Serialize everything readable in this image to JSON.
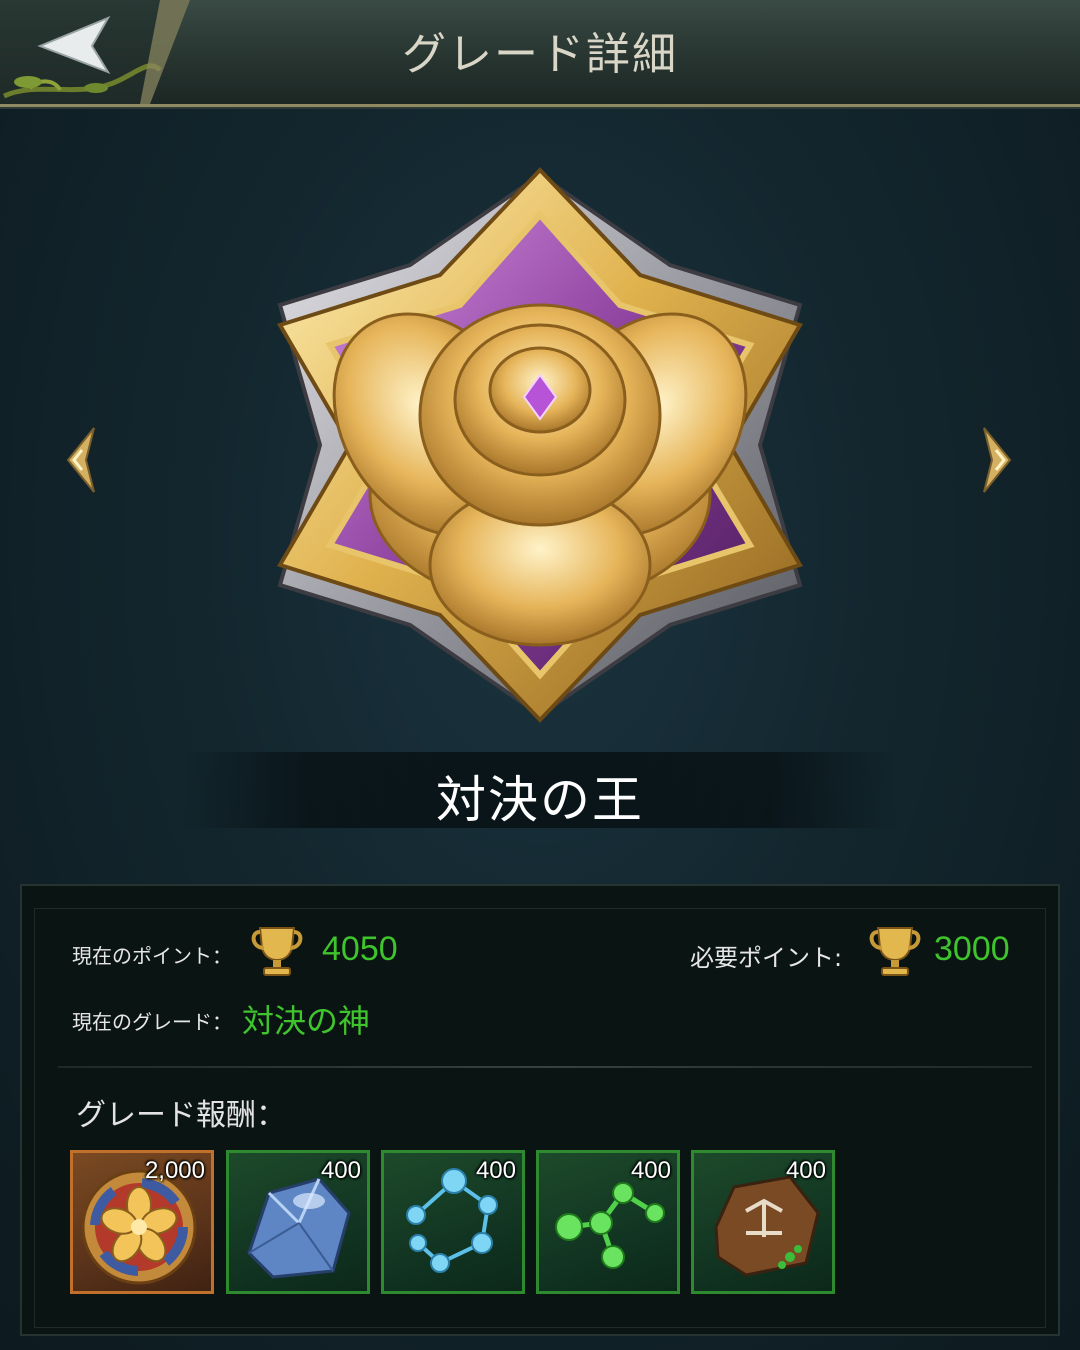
{
  "header": {
    "title": "グレード詳細"
  },
  "grade": {
    "name": "対決の王",
    "emblem_icon": "golden-rose-emblem"
  },
  "info": {
    "current_points_label": "現在のポイント：",
    "current_points_value": "4050",
    "required_points_label": "必要ポイント:",
    "required_points_value": "3000",
    "current_grade_label": "現在のグレード：",
    "current_grade_value": "対決の神"
  },
  "rewards": {
    "label": "グレード報酬：",
    "items": [
      {
        "icon": "gold-flower-medal-icon",
        "count": "2,000"
      },
      {
        "icon": "blue-crystal-icon",
        "count": "400"
      },
      {
        "icon": "blue-molecule-icon",
        "count": "400"
      },
      {
        "icon": "green-molecule-icon",
        "count": "400"
      },
      {
        "icon": "rune-stone-icon",
        "count": "400"
      }
    ]
  },
  "colors": {
    "value_green": "#3fc42d",
    "reward_border_green": "#2e8a2e",
    "reward_border_orange": "#c0702a"
  }
}
